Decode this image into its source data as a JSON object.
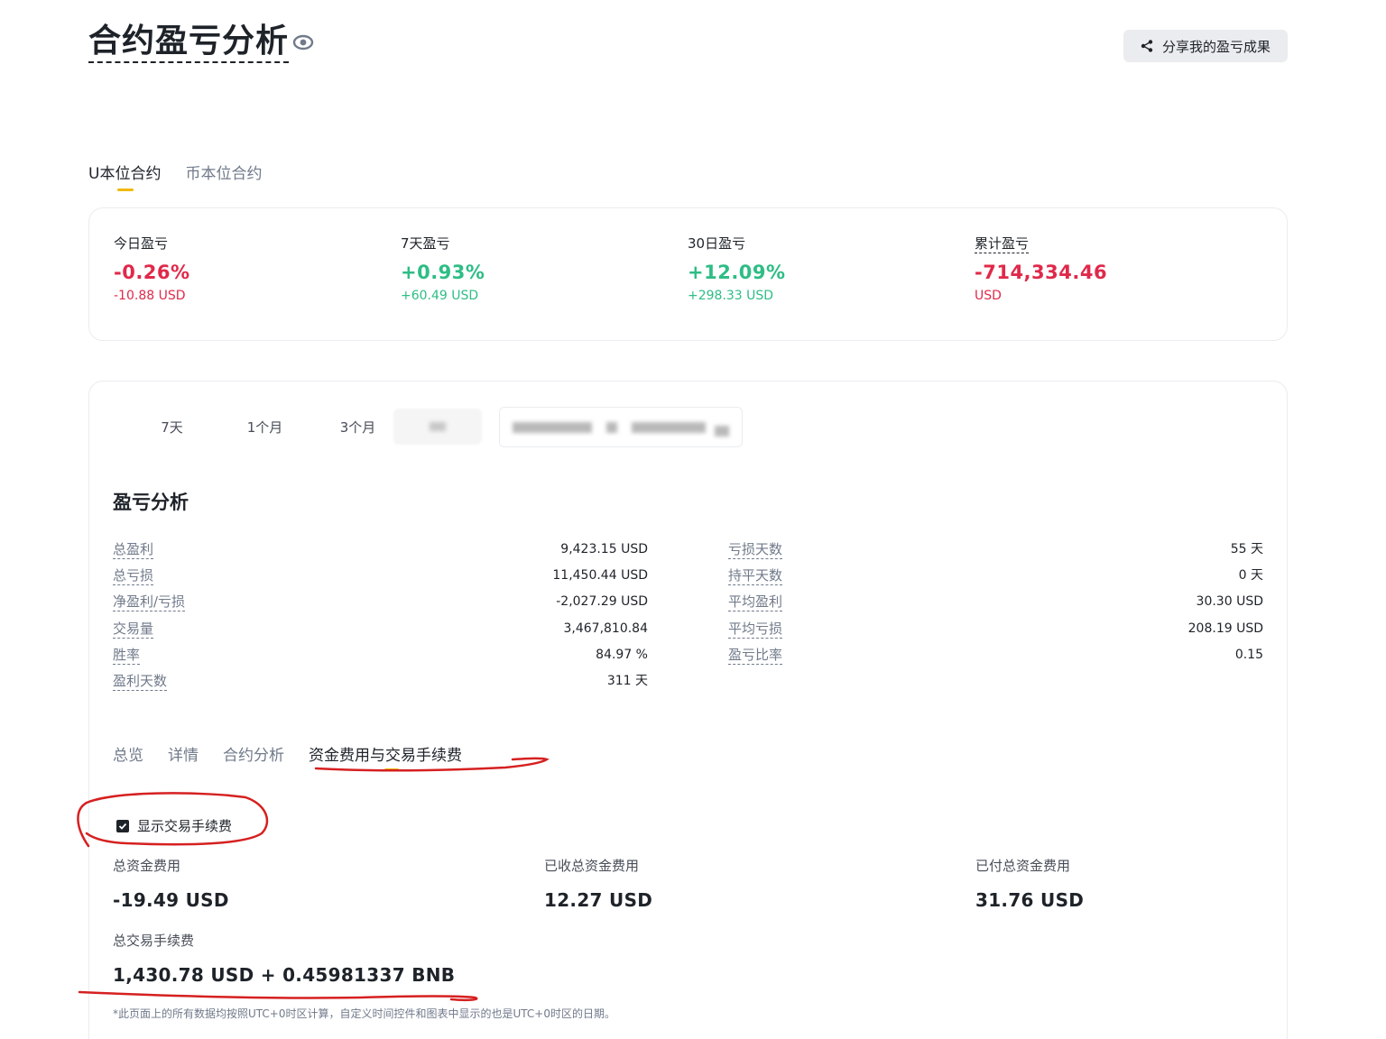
{
  "header": {
    "title": "合约盈亏分析",
    "share_label": "分享我的盈亏成果"
  },
  "contract_tabs": [
    {
      "label": "U本位合约",
      "active": true
    },
    {
      "label": "币本位合约",
      "active": false
    }
  ],
  "summary": {
    "today": {
      "label": "今日盈亏",
      "pct": "-0.26%",
      "usd": "-10.88 USD"
    },
    "week": {
      "label": "7天盈亏",
      "pct": "+0.93%",
      "usd": "+60.49 USD"
    },
    "month": {
      "label": "30日盈亏",
      "pct": "+12.09%",
      "usd": "+298.33 USD"
    },
    "total": {
      "label": "累计盈亏",
      "value": "-714,334.46",
      "unit": "USD"
    }
  },
  "ranges": [
    "7天",
    "1个月",
    "3个月"
  ],
  "analysis": {
    "title": "盈亏分析",
    "left": [
      {
        "label": "总盈利",
        "value": "9,423.15 USD"
      },
      {
        "label": "总亏损",
        "value": "11,450.44 USD"
      },
      {
        "label": "净盈利/亏损",
        "value": "-2,027.29 USD"
      },
      {
        "label": "交易量",
        "value": "3,467,810.84"
      },
      {
        "label": "胜率",
        "value": "84.97 %"
      },
      {
        "label": "盈利天数",
        "value": "311 天"
      }
    ],
    "right": [
      {
        "label": "亏损天数",
        "value": "55 天"
      },
      {
        "label": "持平天数",
        "value": "0 天"
      },
      {
        "label": "平均盈利",
        "value": "30.30 USD"
      },
      {
        "label": "平均亏损",
        "value": "208.19 USD"
      },
      {
        "label": "盈亏比率",
        "value": "0.15"
      }
    ]
  },
  "sub_tabs": [
    {
      "label": "总览",
      "active": false
    },
    {
      "label": "详情",
      "active": false
    },
    {
      "label": "合约分析",
      "active": false
    },
    {
      "label": "资金费用与交易手续费",
      "active": true
    }
  ],
  "fees": {
    "show_fee_label": "显示交易手续费",
    "show_fee_checked": true,
    "total_funding": {
      "label": "总资金费用",
      "value": "-19.49 USD"
    },
    "received_funding": {
      "label": "已收总资金费用",
      "value": "12.27 USD"
    },
    "paid_funding": {
      "label": "已付总资金费用",
      "value": "31.76 USD"
    },
    "total_trading_fee": {
      "label": "总交易手续费",
      "value": "1,430.78 USD + 0.45981337 BNB"
    }
  },
  "footnote": "*此页面上的所有数据均按照UTC+0时区计算，自定义时间控件和图表中显示的也是UTC+0时区的日期。",
  "colors": {
    "loss": "#e0294a",
    "gain": "#2ebd85",
    "accent": "#f0b90b",
    "annotation": "#d62020"
  }
}
